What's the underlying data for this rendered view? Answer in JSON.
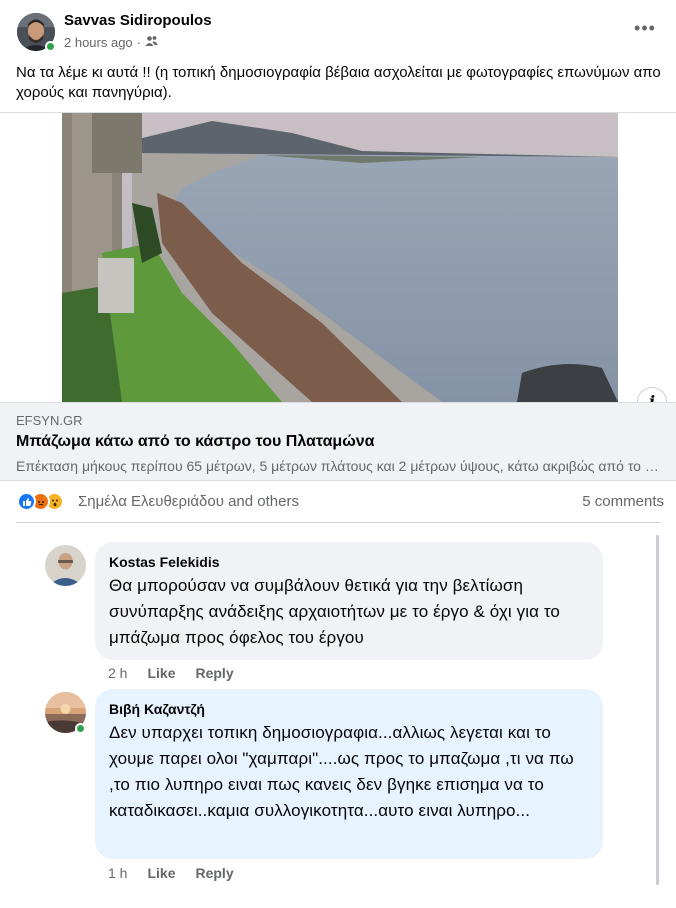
{
  "post": {
    "author": "Savvas Sidiropoulos",
    "time": "2 hours ago",
    "audience_icon": "friends-icon",
    "more_label": "•••",
    "text": "Να τα λέμε κι αυτά !! (η τοπική δημοσιογραφία βέβαια ασχολείται με φωτογραφίες επωνύμων απο χορούς και πανηγύρια)."
  },
  "link_preview": {
    "domain": "EFSYN.GR",
    "title": "Μπάζωμα κάτω από το κάστρο του Πλαταμώνα",
    "description": "Επέκταση μήκους περίπου 65 μέτρων, 5 μέτρων πλάτους και 2 μέτρων ύψους, κάτω ακριβώς από το κάστρο του Πλαταμώνα",
    "info_label": "i"
  },
  "reactions": {
    "icons": [
      "like-icon",
      "angry-icon",
      "wow-icon"
    ],
    "names": "Σημέλα Ελευθεριάδου and others",
    "comments_count": "5 comments"
  },
  "comments": [
    {
      "author": "Kostas Felekidis",
      "text": "Θα μπορούσαν να συμβάλουν θετικά για την βελτίωση συνύπαρξης ανάδειξης αρχαιοτήτων με το έργο & όχι για το μπάζωμα προς όφελος του έργου",
      "time": "2 h",
      "like": "Like",
      "reply": "Reply"
    },
    {
      "author": "Βιβή Καζαντζή",
      "text": "Δεν υπαρχει τοπικη δημοσιογραφια...αλλιως λεγεται και το χουμε παρει ολοι \"χαμπαρι\"....ως προς το μπαζωμα ,τι να πω ,το πιο λυπηρο ειναι πως κανεις δεν βγηκε επισημα να το καταδικασει..καμια συλλογικοτητα...αυτο ειναι λυπηρο...",
      "time": "1 h",
      "like": "Like",
      "reply": "Reply"
    }
  ],
  "colors": {
    "like_blue": "#1877f2",
    "angry_orange": "#e9710f",
    "wow_yellow": "#f7b125",
    "online_green": "#31a24c",
    "highlight_bubble": "#e7f3ff"
  }
}
